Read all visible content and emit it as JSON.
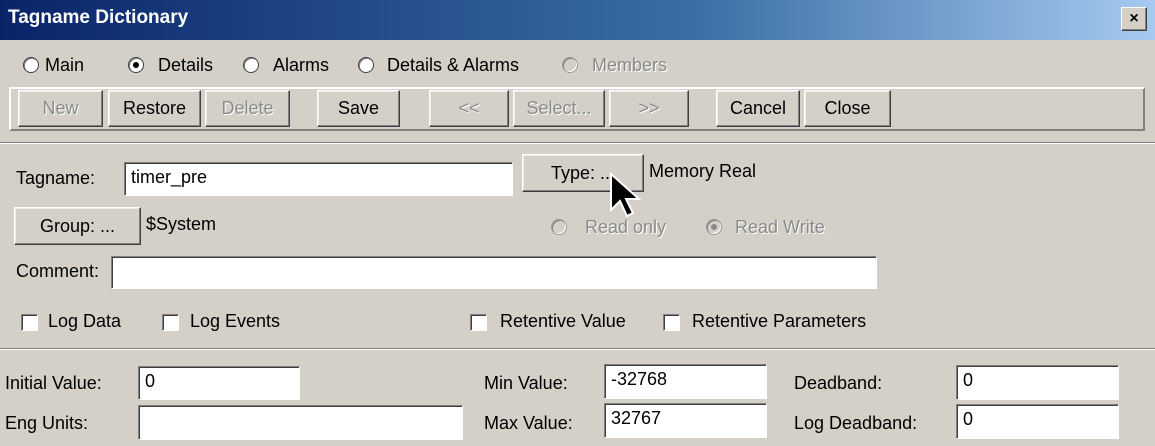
{
  "window": {
    "title": "Tagname Dictionary",
    "close_label": "×"
  },
  "view_options": [
    {
      "label": "Main",
      "checked": false,
      "enabled": true
    },
    {
      "label": "Details",
      "checked": true,
      "enabled": true
    },
    {
      "label": "Alarms",
      "checked": false,
      "enabled": true
    },
    {
      "label": "Details & Alarms",
      "checked": false,
      "enabled": true
    },
    {
      "label": "Members",
      "checked": false,
      "enabled": false
    }
  ],
  "toolbar": {
    "new": "New",
    "restore": "Restore",
    "delete": "Delete",
    "save": "Save",
    "prev": "<<",
    "select": "Select...",
    "next": ">>",
    "cancel": "Cancel",
    "close": "Close"
  },
  "details": {
    "tagname_label": "Tagname:",
    "tagname_value": "timer_pre",
    "type_button": "Type: ...",
    "type_value": "Memory Real",
    "group_button": "Group: ...",
    "group_value": "$System",
    "read_only_label": "Read only",
    "read_write_label": "Read Write",
    "access": "Read Write",
    "comment_label": "Comment:",
    "comment_value": "",
    "log_data_label": "Log Data",
    "log_events_label": "Log Events",
    "retentive_value_label": "Retentive Value",
    "retentive_params_label": "Retentive Parameters",
    "log_data": false,
    "log_events": false,
    "retentive_value": false,
    "retentive_parameters": false
  },
  "values": {
    "initial_label": "Initial Value:",
    "initial_value": "0",
    "eng_units_label": "Eng Units:",
    "eng_units_value": "",
    "min_label": "Min Value:",
    "min_value": "-32768",
    "max_label": "Max Value:",
    "max_value": "32767",
    "deadband_label": "Deadband:",
    "deadband_value": "0",
    "log_deadband_label": "Log Deadband:",
    "log_deadband_value": "0"
  }
}
